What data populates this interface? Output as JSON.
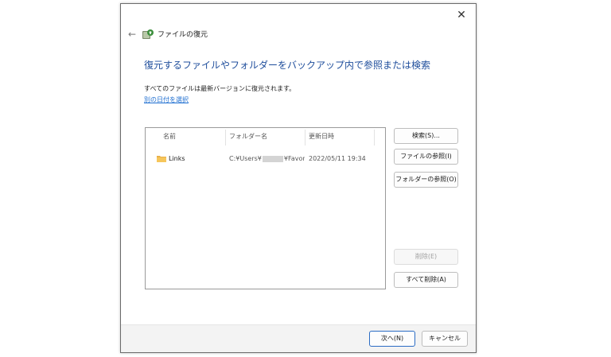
{
  "window": {
    "title": "ファイルの復元",
    "close_glyph": "✕",
    "back_glyph": "←"
  },
  "main": {
    "heading": "復元するファイルやフォルダーをバックアップ内で参照または検索",
    "description": "すべてのファイルは最新バージョンに復元されます。",
    "choose_date_link": "別の日付を選択"
  },
  "file_list": {
    "columns": [
      "名前",
      "フォルダー名",
      "更新日時"
    ],
    "rows": [
      {
        "name": "Links",
        "folder_prefix": "C:¥Users¥",
        "folder_suffix": "¥Favor...",
        "modified": "2022/05/11 19:34",
        "icon": "folder-icon"
      }
    ]
  },
  "side_buttons": {
    "search": "検索(S)...",
    "browse_files": "ファイルの参照(I)",
    "browse_folders": "フォルダーの参照(O)",
    "delete": "削除(E)",
    "delete_all": "すべて削除(A)"
  },
  "footer": {
    "next": "次へ(N)",
    "cancel": "キャンセル"
  },
  "colors": {
    "heading": "#1f4e9c",
    "link": "#1f6fd1",
    "primary_border": "#2b6cc4",
    "footer_bg": "#f3f3f3"
  }
}
